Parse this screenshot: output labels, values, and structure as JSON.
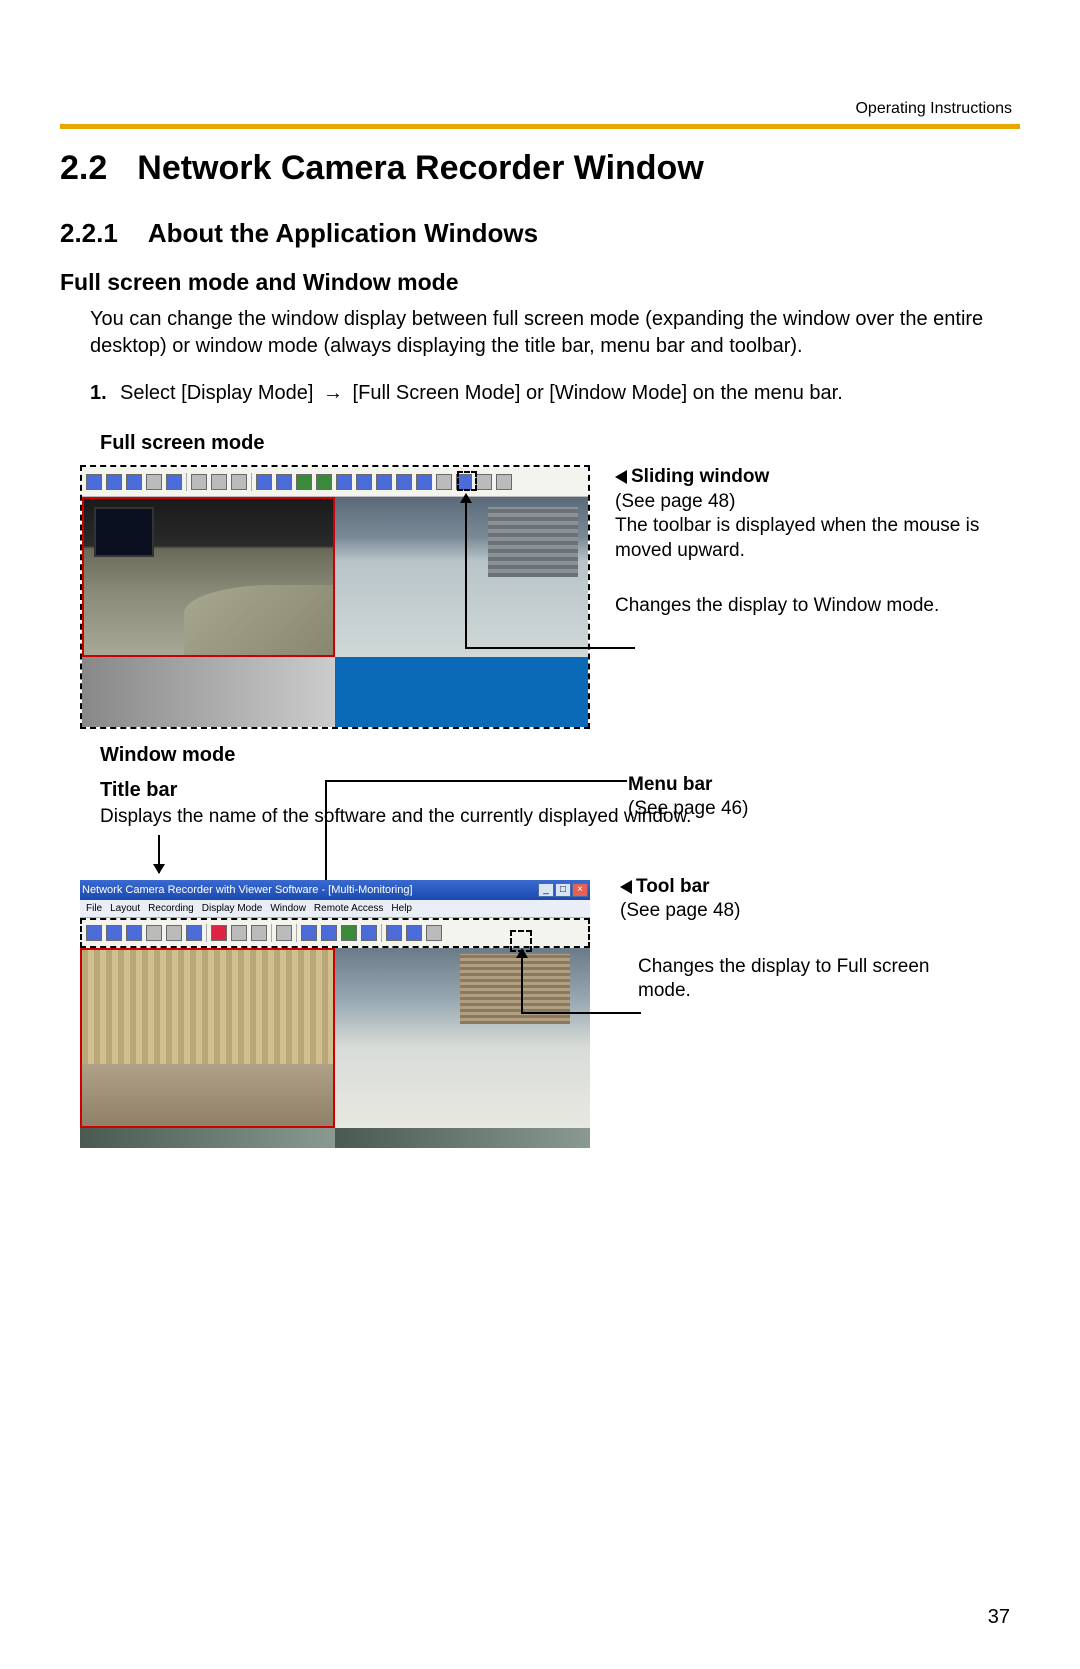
{
  "header": {
    "label": "Operating Instructions"
  },
  "section": {
    "number": "2.2",
    "title": "Network Camera Recorder Window"
  },
  "subsection": {
    "number": "2.2.1",
    "title": "About the Application Windows"
  },
  "mode_heading": "Full screen mode and Window mode",
  "intro": "You can change the window display between full screen mode (expanding the window over the entire desktop) or window mode (always displaying the title bar, menu bar and toolbar).",
  "step1": {
    "num": "1.",
    "text_a": "Select [Display Mode] ",
    "text_b": " [Full Screen Mode] or [Window Mode] on the menu bar."
  },
  "fullscreen": {
    "caption": "Full screen mode",
    "ann_sliding_title": "Sliding window",
    "ann_sliding_ref": "(See page 48)",
    "ann_sliding_body": "The toolbar is displayed when the mouse is moved upward.",
    "ann_change": "Changes the display to Window mode."
  },
  "windowmode": {
    "caption": "Window mode",
    "titlebar_label": "Title bar",
    "titlebar_body": "Displays the name of the software and the currently displayed window.",
    "app_title": "Network Camera Recorder with Viewer Software - [Multi-Monitoring]",
    "menu_items": [
      "File",
      "Layout",
      "Recording",
      "",
      "Display Mode",
      "Window",
      "Remote Access",
      "Help"
    ],
    "ann_menubar_title": "Menu bar",
    "ann_menubar_ref": "(See page 46)",
    "ann_toolbar_title": "Tool bar",
    "ann_toolbar_ref": "(See page 48)",
    "ann_change": "Changes the display to Full screen mode."
  },
  "page_number": "37"
}
